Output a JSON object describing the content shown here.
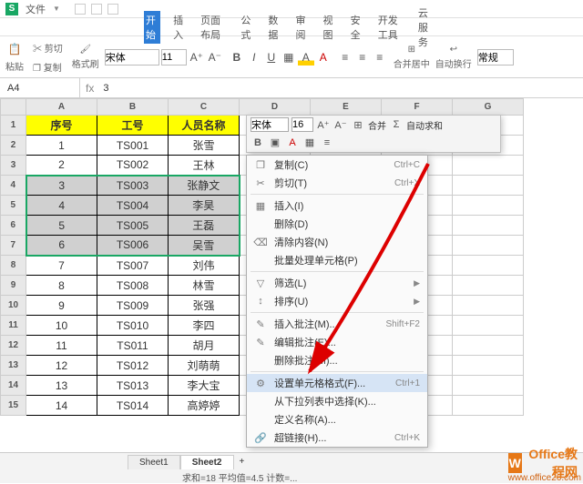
{
  "titlebar": {
    "menu_label": "文件"
  },
  "ribbon_tabs": [
    "开始",
    "插入",
    "页面布局",
    "公式",
    "数据",
    "审阅",
    "视图",
    "安全",
    "开发工具",
    "云服务"
  ],
  "ribbon": {
    "paste": "粘贴",
    "cut": "剪切",
    "copy": "复制",
    "fmtpaint": "格式刷",
    "font": "宋体",
    "size": "11",
    "merge": "合并居中",
    "wrap": "自动换行",
    "normal": "常规"
  },
  "namebox": {
    "ref": "A4",
    "fx": "fx",
    "formula": "3"
  },
  "columns": [
    "A",
    "B",
    "C",
    "D",
    "E",
    "F",
    "G"
  ],
  "headers": {
    "a": "序号",
    "b": "工号",
    "c": "人员名称"
  },
  "rows": [
    {
      "n": 1,
      "a": "1",
      "b": "TS001",
      "c": "张雪"
    },
    {
      "n": 2,
      "a": "2",
      "b": "TS002",
      "c": "王林"
    },
    {
      "n": 3,
      "a": "3",
      "b": "TS003",
      "c": "张静文"
    },
    {
      "n": 4,
      "a": "4",
      "b": "TS004",
      "c": "李昊"
    },
    {
      "n": 5,
      "a": "5",
      "b": "TS005",
      "c": "王磊"
    },
    {
      "n": 6,
      "a": "6",
      "b": "TS006",
      "c": "吴雪"
    },
    {
      "n": 7,
      "a": "7",
      "b": "TS007",
      "c": "刘伟"
    },
    {
      "n": 8,
      "a": "8",
      "b": "TS008",
      "c": "林雪"
    },
    {
      "n": 9,
      "a": "9",
      "b": "TS009",
      "c": "张强"
    },
    {
      "n": 10,
      "a": "10",
      "b": "TS010",
      "c": "李四"
    },
    {
      "n": 11,
      "a": "11",
      "b": "TS011",
      "c": "胡月"
    },
    {
      "n": 12,
      "a": "12",
      "b": "TS012",
      "c": "刘萌萌"
    },
    {
      "n": 13,
      "a": "13",
      "b": "TS013",
      "c": "李大宝"
    },
    {
      "n": 14,
      "a": "14",
      "b": "TS014",
      "c": "高婷婷"
    }
  ],
  "minibar": {
    "font": "宋体",
    "size": "16",
    "merge": "合并",
    "sum": "自动求和"
  },
  "context_menu": [
    {
      "icon": "❐",
      "label": "复制(C)",
      "shortcut": "Ctrl+C"
    },
    {
      "icon": "✂",
      "label": "剪切(T)",
      "shortcut": "Ctrl+X"
    },
    {
      "sep": true
    },
    {
      "icon": "▦",
      "label": "插入(I)"
    },
    {
      "icon": "",
      "label": "删除(D)"
    },
    {
      "icon": "⌫",
      "label": "清除内容(N)"
    },
    {
      "icon": "",
      "label": "批量处理单元格(P)"
    },
    {
      "sep": true
    },
    {
      "icon": "▽",
      "label": "筛选(L)",
      "sub": true
    },
    {
      "icon": "↕",
      "label": "排序(U)",
      "sub": true
    },
    {
      "sep": true
    },
    {
      "icon": "✎",
      "label": "插入批注(M)...",
      "shortcut": "Shift+F2"
    },
    {
      "icon": "✎",
      "label": "编辑批注(E)..."
    },
    {
      "icon": "",
      "label": "删除批注(M)..."
    },
    {
      "sep": true
    },
    {
      "icon": "⚙",
      "label": "设置单元格格式(F)...",
      "shortcut": "Ctrl+1",
      "hover": true
    },
    {
      "icon": "",
      "label": "从下拉列表中选择(K)..."
    },
    {
      "icon": "",
      "label": "定义名称(A)..."
    },
    {
      "icon": "🔗",
      "label": "超链接(H)...",
      "shortcut": "Ctrl+K"
    }
  ],
  "sheets": {
    "s1": "Sheet1",
    "s2": "Sheet2"
  },
  "status": "求和=18  平均值=4.5  计数=...",
  "watermark": {
    "brand": "Office教程网",
    "url": "www.office26.com"
  }
}
